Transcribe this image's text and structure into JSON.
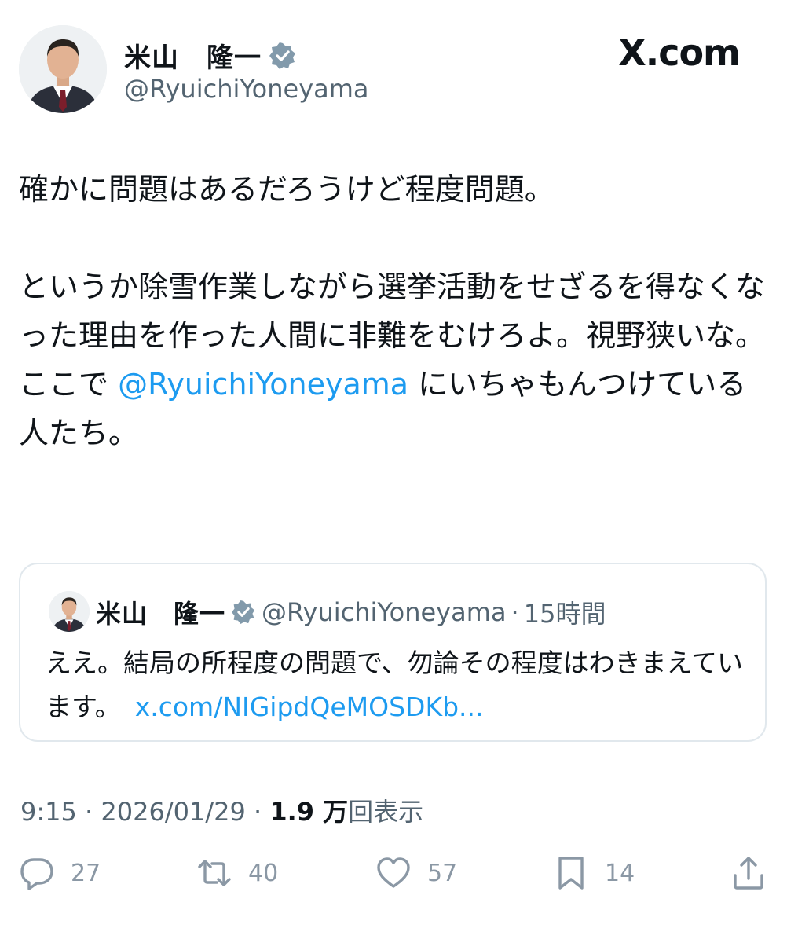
{
  "header": {
    "display_name": "米山　隆一",
    "handle": "@RyuichiYoneyama",
    "brand": "X.com"
  },
  "tweet": {
    "text_before_mention": "確かに問題はあるだろうけど程度問題。\n\nというか除雪作業しながら選挙活動をせざるを得なくなった理由を作った人間に非難をむけろよ。視野狭いな。\nここで ",
    "mention": "@RyuichiYoneyama",
    "text_after_mention": " にいちゃもんつけている人たち。"
  },
  "quoted": {
    "display_name": "米山　隆一",
    "handle": "@RyuichiYoneyama",
    "separator": "·",
    "time": "15時間",
    "text": "ええ。結局の所程度の問題で、勿論その程度はわきまえています。",
    "link": "x.com/NIGipdQeMOSDKb..."
  },
  "meta": {
    "time": "9:15",
    "sep1": " · ",
    "date": "2026/01/29",
    "sep2": " · ",
    "views_count": "1.9 万",
    "views_label": "回表示"
  },
  "actions": {
    "replies": "27",
    "reposts": "40",
    "likes": "57",
    "bookmarks": "14"
  },
  "colors": {
    "accent": "#1d9bf0",
    "verified": "#829aab",
    "muted": "#536471"
  }
}
